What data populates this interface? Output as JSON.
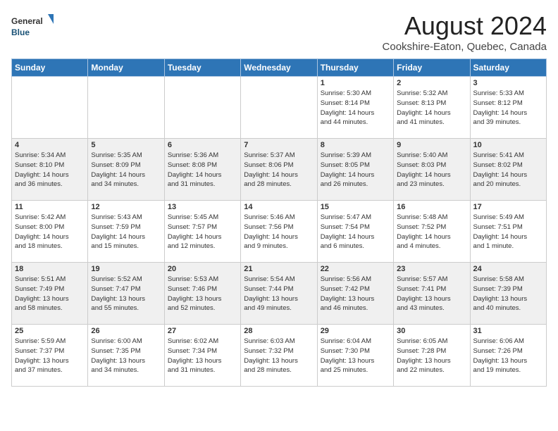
{
  "header": {
    "logo_general": "General",
    "logo_blue": "Blue",
    "month_title": "August 2024",
    "location": "Cookshire-Eaton, Quebec, Canada"
  },
  "weekdays": [
    "Sunday",
    "Monday",
    "Tuesday",
    "Wednesday",
    "Thursday",
    "Friday",
    "Saturday"
  ],
  "weeks": [
    [
      {
        "day": "",
        "detail": ""
      },
      {
        "day": "",
        "detail": ""
      },
      {
        "day": "",
        "detail": ""
      },
      {
        "day": "",
        "detail": ""
      },
      {
        "day": "1",
        "detail": "Sunrise: 5:30 AM\nSunset: 8:14 PM\nDaylight: 14 hours\nand 44 minutes."
      },
      {
        "day": "2",
        "detail": "Sunrise: 5:32 AM\nSunset: 8:13 PM\nDaylight: 14 hours\nand 41 minutes."
      },
      {
        "day": "3",
        "detail": "Sunrise: 5:33 AM\nSunset: 8:12 PM\nDaylight: 14 hours\nand 39 minutes."
      }
    ],
    [
      {
        "day": "4",
        "detail": "Sunrise: 5:34 AM\nSunset: 8:10 PM\nDaylight: 14 hours\nand 36 minutes."
      },
      {
        "day": "5",
        "detail": "Sunrise: 5:35 AM\nSunset: 8:09 PM\nDaylight: 14 hours\nand 34 minutes."
      },
      {
        "day": "6",
        "detail": "Sunrise: 5:36 AM\nSunset: 8:08 PM\nDaylight: 14 hours\nand 31 minutes."
      },
      {
        "day": "7",
        "detail": "Sunrise: 5:37 AM\nSunset: 8:06 PM\nDaylight: 14 hours\nand 28 minutes."
      },
      {
        "day": "8",
        "detail": "Sunrise: 5:39 AM\nSunset: 8:05 PM\nDaylight: 14 hours\nand 26 minutes."
      },
      {
        "day": "9",
        "detail": "Sunrise: 5:40 AM\nSunset: 8:03 PM\nDaylight: 14 hours\nand 23 minutes."
      },
      {
        "day": "10",
        "detail": "Sunrise: 5:41 AM\nSunset: 8:02 PM\nDaylight: 14 hours\nand 20 minutes."
      }
    ],
    [
      {
        "day": "11",
        "detail": "Sunrise: 5:42 AM\nSunset: 8:00 PM\nDaylight: 14 hours\nand 18 minutes."
      },
      {
        "day": "12",
        "detail": "Sunrise: 5:43 AM\nSunset: 7:59 PM\nDaylight: 14 hours\nand 15 minutes."
      },
      {
        "day": "13",
        "detail": "Sunrise: 5:45 AM\nSunset: 7:57 PM\nDaylight: 14 hours\nand 12 minutes."
      },
      {
        "day": "14",
        "detail": "Sunrise: 5:46 AM\nSunset: 7:56 PM\nDaylight: 14 hours\nand 9 minutes."
      },
      {
        "day": "15",
        "detail": "Sunrise: 5:47 AM\nSunset: 7:54 PM\nDaylight: 14 hours\nand 6 minutes."
      },
      {
        "day": "16",
        "detail": "Sunrise: 5:48 AM\nSunset: 7:52 PM\nDaylight: 14 hours\nand 4 minutes."
      },
      {
        "day": "17",
        "detail": "Sunrise: 5:49 AM\nSunset: 7:51 PM\nDaylight: 14 hours\nand 1 minute."
      }
    ],
    [
      {
        "day": "18",
        "detail": "Sunrise: 5:51 AM\nSunset: 7:49 PM\nDaylight: 13 hours\nand 58 minutes."
      },
      {
        "day": "19",
        "detail": "Sunrise: 5:52 AM\nSunset: 7:47 PM\nDaylight: 13 hours\nand 55 minutes."
      },
      {
        "day": "20",
        "detail": "Sunrise: 5:53 AM\nSunset: 7:46 PM\nDaylight: 13 hours\nand 52 minutes."
      },
      {
        "day": "21",
        "detail": "Sunrise: 5:54 AM\nSunset: 7:44 PM\nDaylight: 13 hours\nand 49 minutes."
      },
      {
        "day": "22",
        "detail": "Sunrise: 5:56 AM\nSunset: 7:42 PM\nDaylight: 13 hours\nand 46 minutes."
      },
      {
        "day": "23",
        "detail": "Sunrise: 5:57 AM\nSunset: 7:41 PM\nDaylight: 13 hours\nand 43 minutes."
      },
      {
        "day": "24",
        "detail": "Sunrise: 5:58 AM\nSunset: 7:39 PM\nDaylight: 13 hours\nand 40 minutes."
      }
    ],
    [
      {
        "day": "25",
        "detail": "Sunrise: 5:59 AM\nSunset: 7:37 PM\nDaylight: 13 hours\nand 37 minutes."
      },
      {
        "day": "26",
        "detail": "Sunrise: 6:00 AM\nSunset: 7:35 PM\nDaylight: 13 hours\nand 34 minutes."
      },
      {
        "day": "27",
        "detail": "Sunrise: 6:02 AM\nSunset: 7:34 PM\nDaylight: 13 hours\nand 31 minutes."
      },
      {
        "day": "28",
        "detail": "Sunrise: 6:03 AM\nSunset: 7:32 PM\nDaylight: 13 hours\nand 28 minutes."
      },
      {
        "day": "29",
        "detail": "Sunrise: 6:04 AM\nSunset: 7:30 PM\nDaylight: 13 hours\nand 25 minutes."
      },
      {
        "day": "30",
        "detail": "Sunrise: 6:05 AM\nSunset: 7:28 PM\nDaylight: 13 hours\nand 22 minutes."
      },
      {
        "day": "31",
        "detail": "Sunrise: 6:06 AM\nSunset: 7:26 PM\nDaylight: 13 hours\nand 19 minutes."
      }
    ]
  ]
}
